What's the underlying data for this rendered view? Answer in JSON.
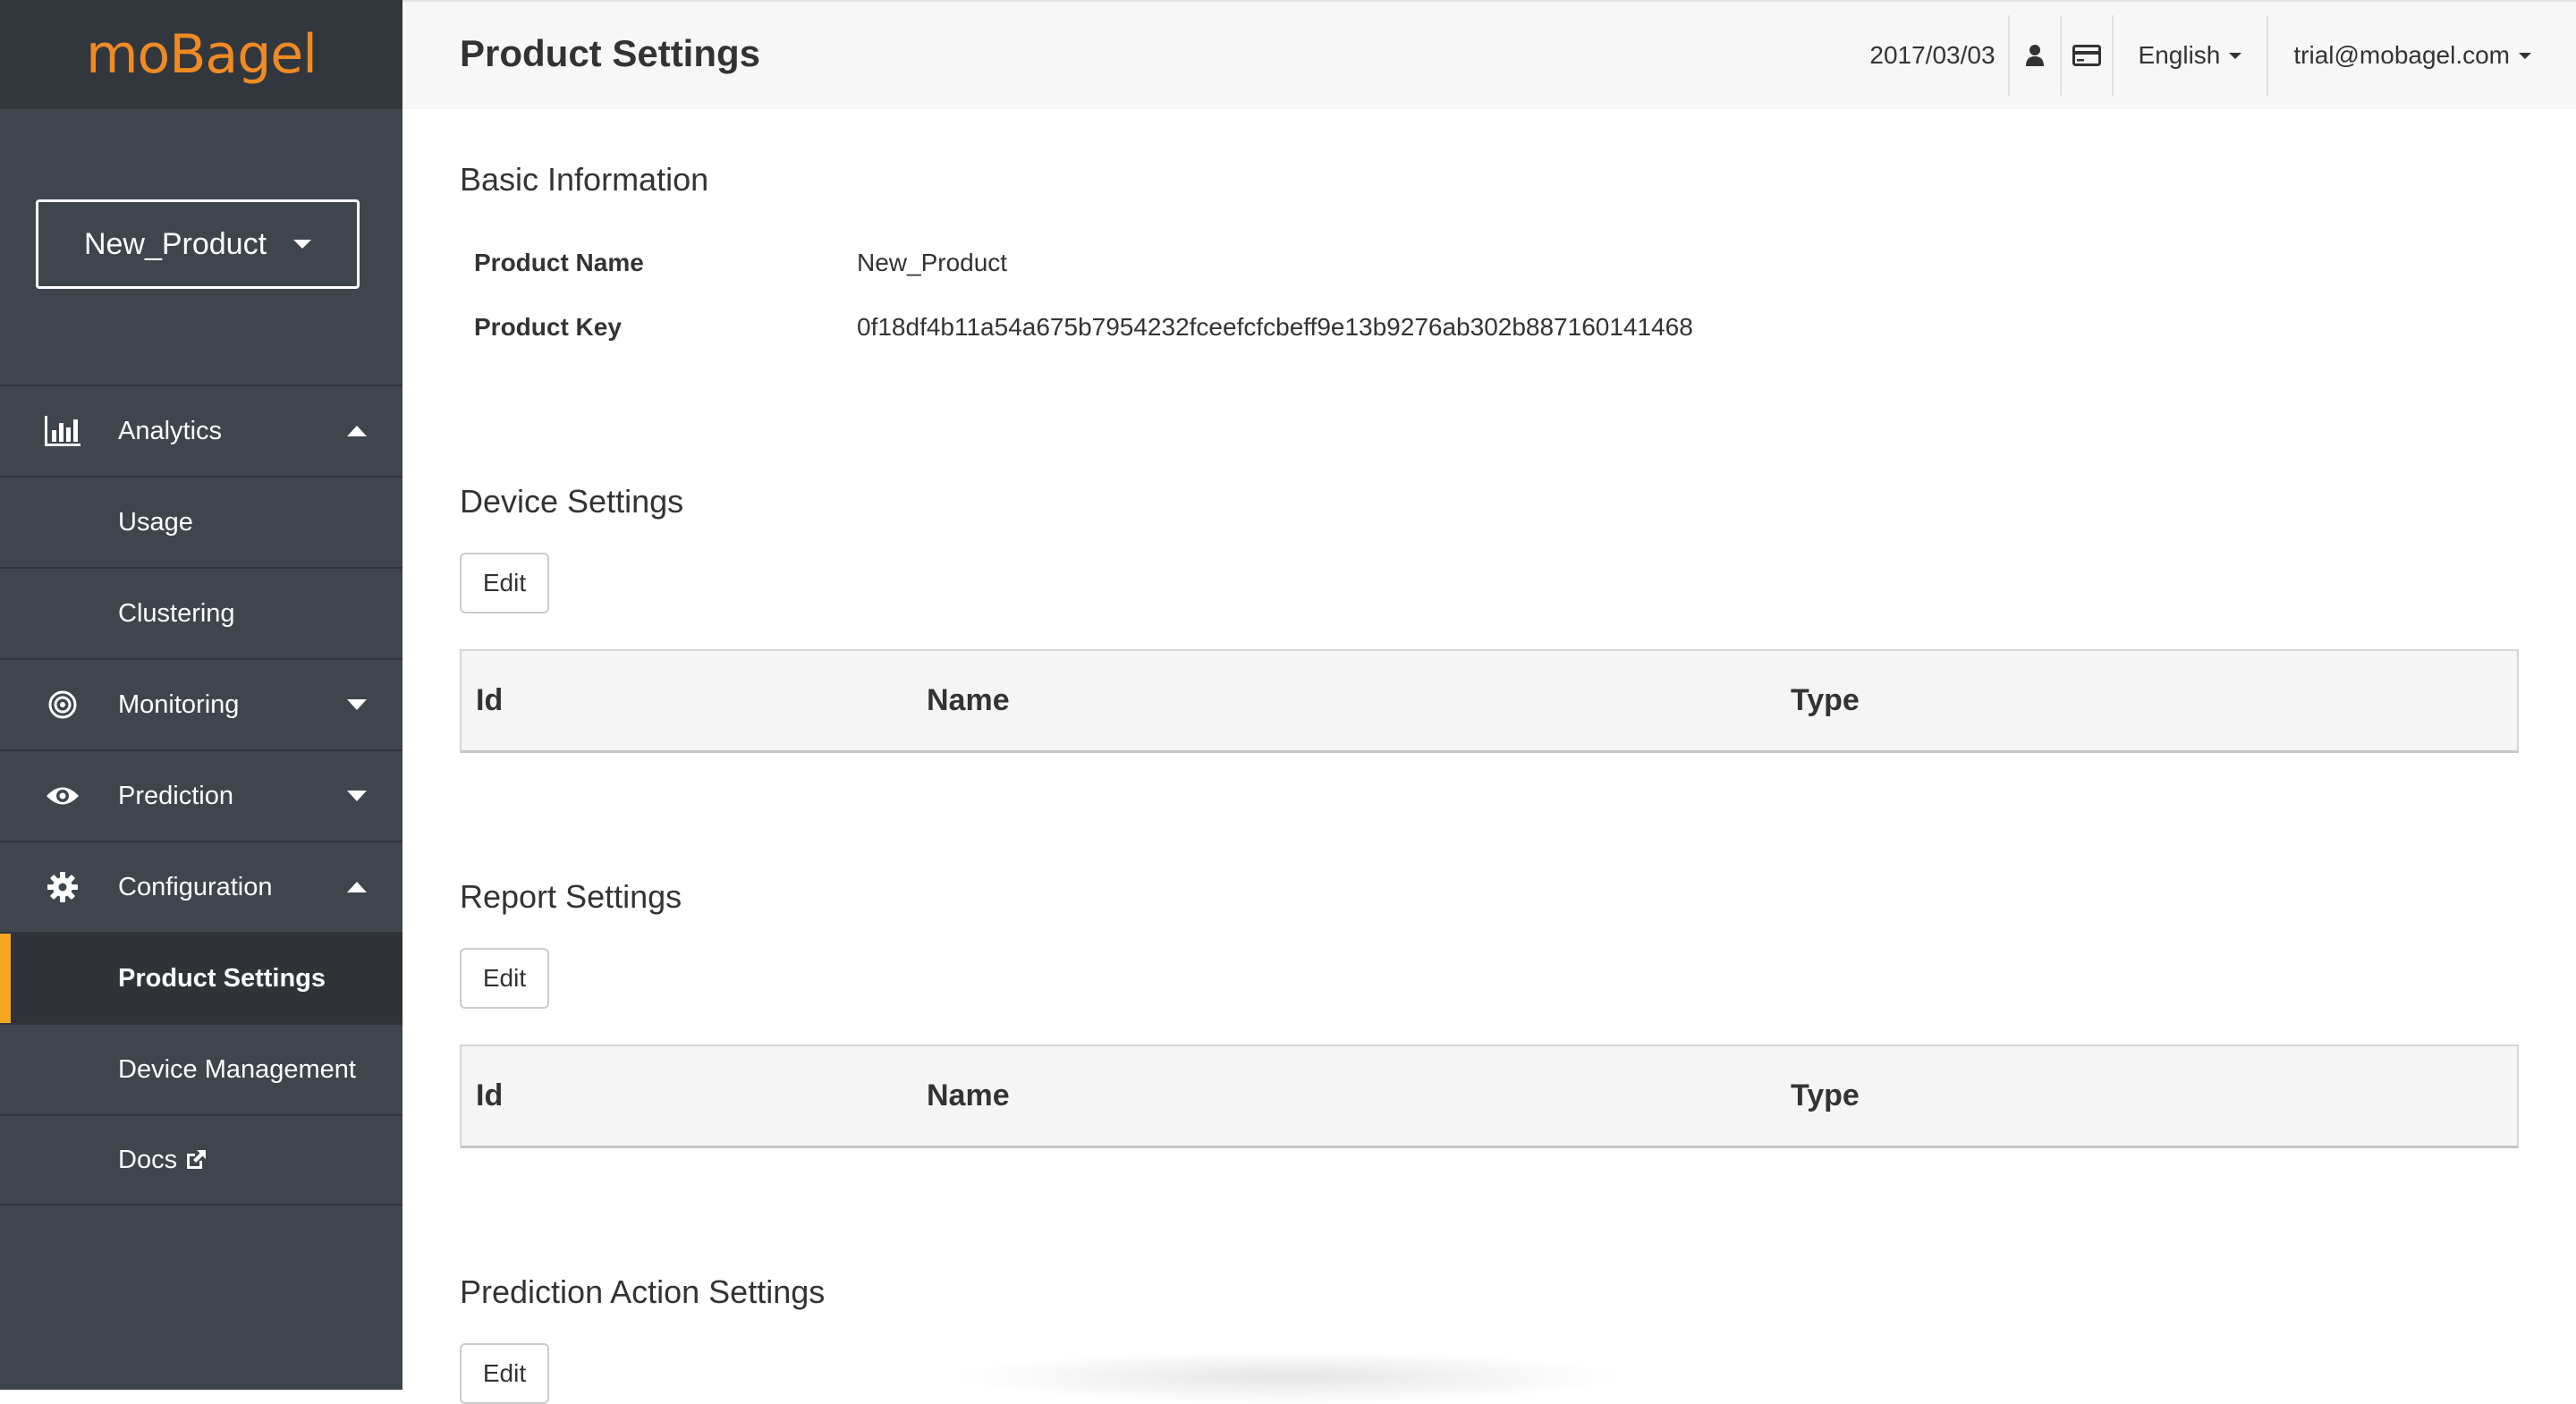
{
  "brand": {
    "logo_text": "moBagel",
    "logo_color": "#f08a24"
  },
  "sidebar": {
    "product_selector": "New_Product",
    "items": [
      {
        "label": "Analytics",
        "icon": "bar-chart-icon",
        "arrow": "up"
      },
      {
        "label": "Usage"
      },
      {
        "label": "Clustering"
      },
      {
        "label": "Monitoring",
        "icon": "target-icon",
        "arrow": "down"
      },
      {
        "label": "Prediction",
        "icon": "eye-icon",
        "arrow": "down"
      },
      {
        "label": "Configuration",
        "icon": "gear-icon",
        "arrow": "up"
      },
      {
        "label": "Product Settings",
        "active": true
      },
      {
        "label": "Device Management"
      },
      {
        "label": "Docs",
        "icon": "external-link-icon"
      }
    ],
    "accent_color": "#f5a623"
  },
  "header": {
    "title": "Product Settings",
    "date": "2017/03/03",
    "language": "English",
    "user_email": "trial@mobagel.com"
  },
  "basic_info": {
    "title": "Basic Information",
    "product_name_label": "Product Name",
    "product_name_value": "New_Product",
    "product_key_label": "Product Key",
    "product_key_value": "0f18df4b11a54a675b7954232fceefcfcbeff9e13b9276ab302b887160141468"
  },
  "device_settings": {
    "title": "Device Settings",
    "edit_label": "Edit",
    "columns": [
      "Id",
      "Name",
      "Type"
    ]
  },
  "report_settings": {
    "title": "Report Settings",
    "edit_label": "Edit",
    "columns": [
      "Id",
      "Name",
      "Type"
    ]
  },
  "prediction_action_settings": {
    "title": "Prediction Action Settings",
    "edit_label": "Edit"
  }
}
